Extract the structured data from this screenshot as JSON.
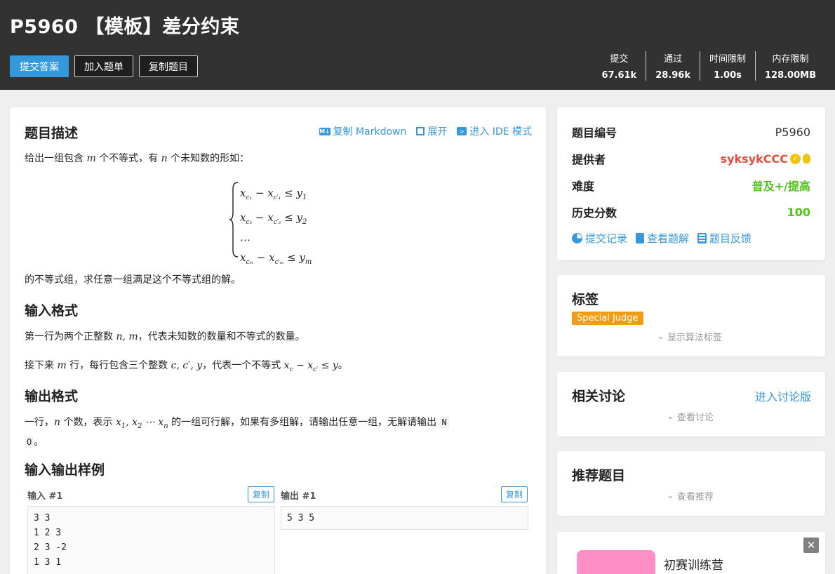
{
  "header": {
    "title": "P5960 【模板】差分约束",
    "buttons": {
      "submit": "提交答案",
      "add_list": "加入题单",
      "copy": "复制题目"
    },
    "stats": [
      {
        "label": "提交",
        "value": "67.61k"
      },
      {
        "label": "通过",
        "value": "28.96k"
      },
      {
        "label": "时间限制",
        "value": "1.00s"
      },
      {
        "label": "内存限制",
        "value": "128.00MB"
      }
    ]
  },
  "main": {
    "description_title": "题目描述",
    "toolbar": {
      "copy_md": "复制 Markdown",
      "expand": "展开",
      "ide": "进入 IDE 模式"
    },
    "desc_text_1a": "给出一组包含",
    "desc_m": "m",
    "desc_text_1b": "个不等式，有",
    "desc_n": "n",
    "desc_text_1c": "个未知数的形如：",
    "system": {
      "row1": "x_{c1} − x_{c'1} ≤ y1",
      "row2": "x_{c2} − x_{c'2} ≤ y2",
      "row3": "⋯",
      "row4": "x_{cm} − x_{c'm} ≤ ym"
    },
    "desc_text_2": "的不等式组，求任意一组满足这个不等式组的解。",
    "input_title": "输入格式",
    "input_line1a": "第一行为两个正整数",
    "input_line1_math": "n, m",
    "input_line1b": "，代表未知数的数量和不等式的数量。",
    "input_line2a": "接下来",
    "input_line2_m": "m",
    "input_line2b": "行，每行包含三个整数",
    "input_line2_math": "c, c′, y",
    "input_line2c": "，代表一个不等式",
    "input_line2_ineq": "x_c − x_{c′} ≤ y",
    "input_line2d": "。",
    "output_title": "输出格式",
    "output_line1a": "一行，",
    "output_n": "n",
    "output_line1b": "个数，表示",
    "output_math": "x1, x2 ⋯ xn",
    "output_line1c": "的一组可行解，如果有多组解，请输出任意一组，无解请输出",
    "output_code_n": "N",
    "output_code_o": "O",
    "output_end": "。",
    "samples_title": "输入输出样例",
    "sample_in_label": "输入 #1",
    "sample_out_label": "输出 #1",
    "copy_label": "复制",
    "sample_in": "3 3\n1 2 3\n2 3 -2\n1 3 1",
    "sample_out": "5 3 5"
  },
  "sidebar": {
    "info": {
      "id_label": "题目编号",
      "id_value": "P5960",
      "provider_label": "提供者",
      "provider_value": "syksykCCC",
      "difficulty_label": "难度",
      "difficulty_value": "普及+/提高",
      "score_label": "历史分数",
      "score_value": "100",
      "links": {
        "records": "提交记录",
        "solutions": "查看题解",
        "feedback": "题目反馈"
      }
    },
    "tags": {
      "title": "标签",
      "tag": "Special Judge",
      "show": "显示算法标签"
    },
    "discuss": {
      "title": "相关讨论",
      "enter": "进入讨论版",
      "view": "查看讨论"
    },
    "recommend": {
      "title": "推荐题目",
      "view": "查看推荐"
    },
    "ad": {
      "title": "初赛训练营"
    }
  },
  "colors": {
    "header_bg": "#323232",
    "accent": "#3498db",
    "provider": "#e74c3c",
    "difficulty": "#52c41a",
    "tag_bg": "#f39c11"
  }
}
